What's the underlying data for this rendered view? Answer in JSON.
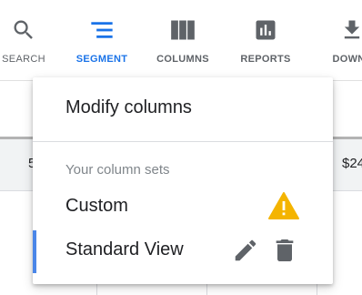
{
  "toolbar": {
    "items": [
      {
        "label": "SEARCH",
        "icon": "search-icon"
      },
      {
        "label": "SEGMENT",
        "icon": "segment-icon",
        "active": true
      },
      {
        "label": "COLUMNS",
        "icon": "columns-icon"
      },
      {
        "label": "REPORTS",
        "icon": "reports-icon"
      },
      {
        "label": "DOWNL",
        "icon": "download-icon"
      }
    ]
  },
  "table": {
    "left_fragment": "5",
    "right_fragment": "$24"
  },
  "menu": {
    "modify_label": "Modify columns",
    "section_heading": "Your column sets",
    "sets": [
      {
        "label": "Custom",
        "status_icon": "warning-icon"
      },
      {
        "label": "Standard View",
        "selected": true,
        "actions": [
          "edit-icon",
          "delete-icon"
        ]
      }
    ]
  },
  "colors": {
    "accent": "#1a73e8",
    "selected_bar": "#4a86e8",
    "icon_gray": "#5f6368",
    "warning": "#f4b400",
    "text": "#202124",
    "muted_text": "#80868b"
  }
}
